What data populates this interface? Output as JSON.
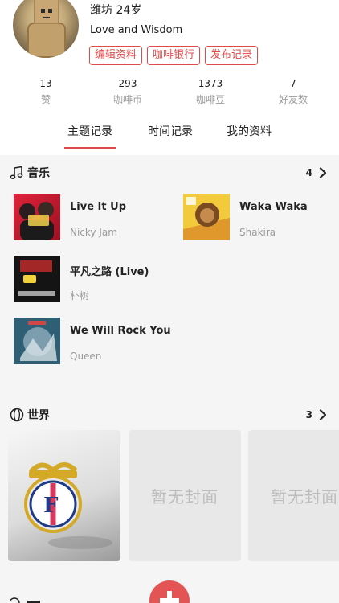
{
  "profile": {
    "name_line": "潍坊 24岁",
    "bio": "Love and Wisdom",
    "actions": [
      "编辑资料",
      "咖啡银行",
      "发布记录"
    ]
  },
  "stats": [
    {
      "value": "13",
      "label": "赞"
    },
    {
      "value": "293",
      "label": "咖啡币"
    },
    {
      "value": "1373",
      "label": "咖啡豆"
    },
    {
      "value": "7",
      "label": "好友数"
    }
  ],
  "tabs": [
    {
      "label": "主题记录",
      "active": true
    },
    {
      "label": "时间记录",
      "active": false
    },
    {
      "label": "我的资料",
      "active": false
    }
  ],
  "music": {
    "title": "音乐",
    "count": "4",
    "icon": "music-note-icon",
    "songs": [
      {
        "title": "Live It Up",
        "artist": "Nicky Jam"
      },
      {
        "title": "Waka Waka",
        "artist": "Shakira"
      },
      {
        "title": "平凡之路 (Live)",
        "artist": "朴树"
      },
      {
        "title": "We Will Rock You",
        "artist": "Queen"
      }
    ]
  },
  "world": {
    "title": "世界",
    "count": "3",
    "icon": "globe-icon",
    "placeholders": [
      "暂无封面",
      "暂无封面"
    ]
  },
  "colors": {
    "accent": "#e04a4a",
    "muted": "#9a9a9a",
    "background": "#f5f5f5"
  }
}
